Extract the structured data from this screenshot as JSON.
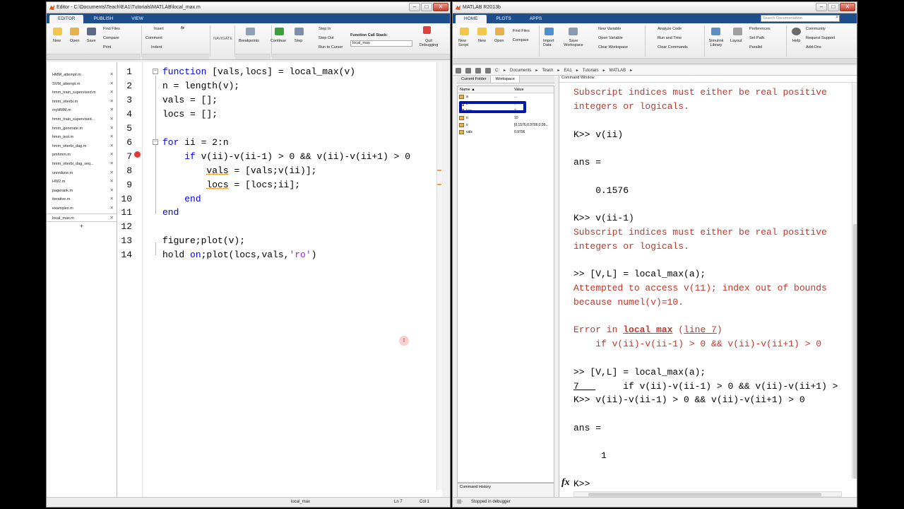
{
  "editor": {
    "title": "Editor - C:\\Documents\\Teach\\EA1\\Tutorials\\MATLAB\\local_max.m",
    "tabs": [
      "EDITOR",
      "PUBLISH",
      "VIEW"
    ],
    "ribbon": {
      "new": "New",
      "open": "Open",
      "save": "Save",
      "find_files": "Find Files",
      "compare": "Compare",
      "print": "Print",
      "insert": "Insert",
      "comment": "Comment",
      "indent": "Indent",
      "navigate": "NAVIGATE",
      "breakpoints": "Breakpoints",
      "continue": "Continue",
      "step": "Step",
      "step_in": "Step In",
      "step_out": "Step Out",
      "run_to_cursor": "Run to Cursor",
      "call_stack_label": "Function Call Stack:",
      "call_stack_value": "local_max",
      "quit_debugging": "Quit Debugging"
    },
    "files": [
      "HMM_attempt.m",
      "SVM_attempt.m",
      "hmm_train_supervised.m",
      "hmm_viterbi.m",
      "myHMM.m",
      "hmm_train_supervised...",
      "hmm_generate.m",
      "hmm_test.m",
      "hmm_viterbi_dag.m",
      "pmhmm.m",
      "hmm_viterbi_dag_seq...",
      "unreduce.m",
      "HW2.m",
      "pagerank.m",
      "iterative.m",
      "examples.m",
      "local_max.m"
    ],
    "add_tab": "+",
    "line_numbers": [
      "1",
      "2",
      "3",
      "4",
      "5",
      "6",
      "7",
      "8",
      "9",
      "10",
      "11",
      "12",
      "13",
      "14"
    ],
    "status": {
      "function": "local_max",
      "ln": "Ln  7",
      "col": "Col  1"
    }
  },
  "matlab": {
    "title": "MATLAB R2013b",
    "tabs": [
      "HOME",
      "PLOTS",
      "APPS"
    ],
    "search_placeholder": "Search Documentation",
    "ribbon": {
      "new_script": "New Script",
      "new": "New",
      "open": "Open",
      "find_files": "Find Files",
      "compare": "Compare",
      "import_data": "Import Data",
      "save_workspace": "Save Workspace",
      "new_variable": "New Variable",
      "open_variable": "Open Variable",
      "clear_workspace": "Clear Workspace",
      "analyze_code": "Analyze Code",
      "run_and_time": "Run and Time",
      "clear_commands": "Clear Commands",
      "simulink": "Simulink Library",
      "layout": "Layout",
      "preferences": "Preferences",
      "set_path": "Set Path",
      "parallel": "Parallel",
      "help": "Help",
      "community": "Community",
      "request_support": "Request Support",
      "add_ons": "Add-Ons"
    },
    "path": [
      "C:",
      "Documents",
      "Teach",
      "EA1",
      "Tutorials",
      "MATLAB"
    ],
    "panels": {
      "current_folder": "Current Folder",
      "workspace": "Workspace",
      "command_window": "Command Window",
      "command_history": "Command History"
    },
    "workspace_cols": {
      "name": "Name ▲",
      "value": "Value"
    },
    "workspace": [
      {
        "name": "a",
        "value": "..."
      },
      {
        "name": "ii",
        "value": "7"
      },
      {
        "name": "locs",
        "value": "2"
      },
      {
        "name": "n",
        "value": "10"
      },
      {
        "name": "v",
        "value": "[0.1576;0.9706;0.95..."
      },
      {
        "name": "vals",
        "value": "0.9706"
      }
    ],
    "prompt": "K>>",
    "status": "Stopped in debugger"
  }
}
